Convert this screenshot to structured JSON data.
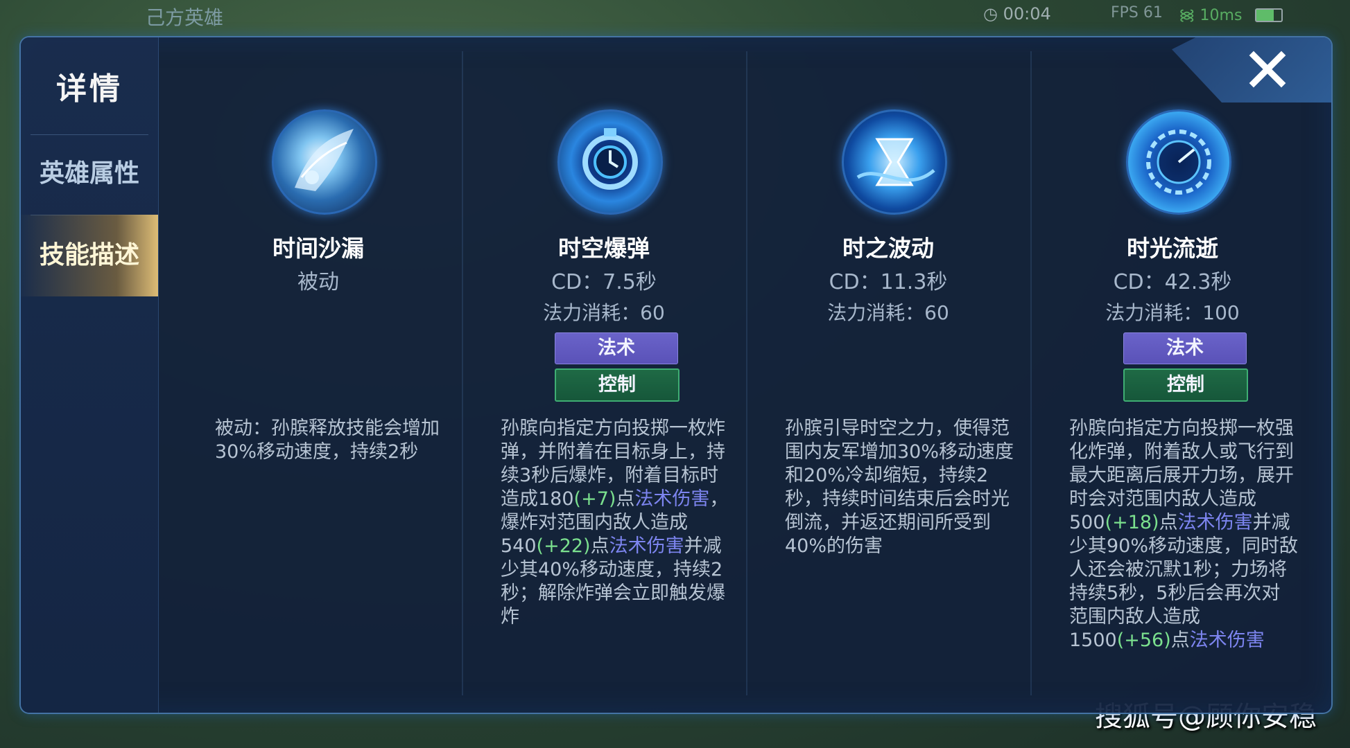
{
  "hud": {
    "top_left_title": "己方英雄",
    "timer": "00:04",
    "fps": "FPS 61",
    "ping": "10ms"
  },
  "watermark": "搜狐号@顾你安稳",
  "sidebar": {
    "title": "详情",
    "items": [
      {
        "label": "英雄属性",
        "active": false
      },
      {
        "label": "技能描述",
        "active": true
      }
    ]
  },
  "skills": [
    {
      "name": "时间沙漏",
      "subtitle": "被动",
      "cd": "",
      "mana": "",
      "tags": [],
      "icon": "hourglass-wing-icon",
      "desc": [
        {
          "t": "被动：孙膑释放技能会增加30%移动速度，持续2秒",
          "c": "n"
        }
      ]
    },
    {
      "name": "时空爆弹",
      "subtitle": "",
      "cd": "CD：7.5秒",
      "mana": "法力消耗：60",
      "tags": [
        {
          "label": "法术",
          "kind": "magic"
        },
        {
          "label": "控制",
          "kind": "control"
        }
      ],
      "icon": "time-bomb-icon",
      "desc": [
        {
          "t": "孙膑向指定方向投掷一枚炸弹，并附着在目标身上，持续3秒后爆炸，附着目标时造成180",
          "c": "n"
        },
        {
          "t": "(+7)",
          "c": "g"
        },
        {
          "t": "点",
          "c": "n"
        },
        {
          "t": "法术伤害",
          "c": "p"
        },
        {
          "t": "，爆炸对范围内敌人造成540",
          "c": "n"
        },
        {
          "t": "(+22)",
          "c": "g"
        },
        {
          "t": "点",
          "c": "n"
        },
        {
          "t": "法术伤害",
          "c": "p"
        },
        {
          "t": "并减少其40%移动速度，持续2秒；解除炸弹会立即触发爆炸",
          "c": "n"
        }
      ]
    },
    {
      "name": "时之波动",
      "subtitle": "",
      "cd": "CD：11.3秒",
      "mana": "法力消耗：60",
      "tags": [],
      "icon": "time-wave-icon",
      "desc": [
        {
          "t": "孙膑引导时空之力，使得范围内友军增加30%移动速度和20%冷却缩短，持续2秒，持续时间结束后会时光倒流，并返还期间所受到40%的伤害",
          "c": "n"
        }
      ]
    },
    {
      "name": "时光流逝",
      "subtitle": "",
      "cd": "CD：42.3秒",
      "mana": "法力消耗：100",
      "tags": [
        {
          "label": "法术",
          "kind": "magic"
        },
        {
          "label": "控制",
          "kind": "control"
        }
      ],
      "icon": "clock-field-icon",
      "desc": [
        {
          "t": "孙膑向指定方向投掷一枚强化炸弹，附着敌人或飞行到最大距离后展开力场，展开时会对范围内敌人造成500",
          "c": "n"
        },
        {
          "t": "(+18)",
          "c": "g"
        },
        {
          "t": "点",
          "c": "n"
        },
        {
          "t": "法术伤害",
          "c": "p"
        },
        {
          "t": "并减少其90%移动速度，同时敌人还会被沉默1秒；力场将持续5秒，5秒后会再次对范围内敌人造成1500",
          "c": "n"
        },
        {
          "t": "(+56)",
          "c": "g"
        },
        {
          "t": "点",
          "c": "n"
        },
        {
          "t": "法术伤害",
          "c": "p"
        }
      ]
    }
  ],
  "colors": {
    "panel_bg": "#12203a",
    "green_value": "#7be08e",
    "purple_keyword": "#7d85f0",
    "magic_tag": "#5a52b8",
    "control_tag": "#16573a",
    "active_tab": "#e8c478"
  }
}
